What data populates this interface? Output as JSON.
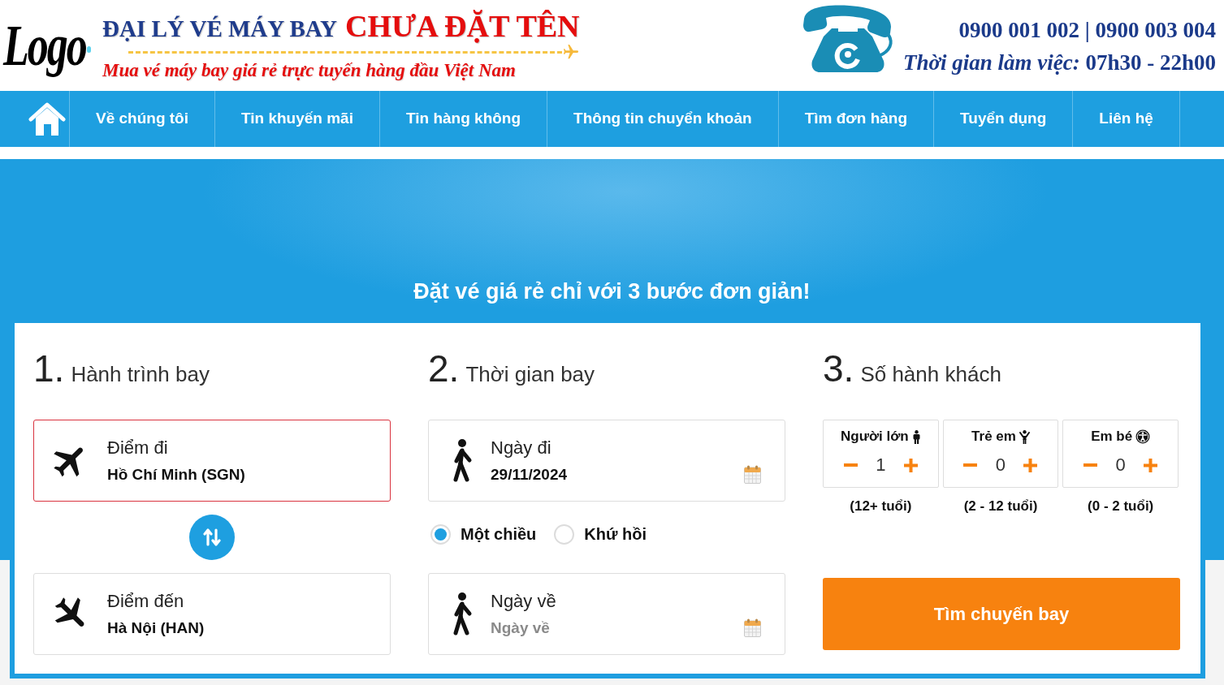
{
  "header": {
    "logo": "Logo",
    "title": "ĐẠI LÝ VÉ MÁY BAY",
    "title_highlight": "CHƯA ĐẶT TÊN",
    "tagline": "Mua vé máy bay giá rẻ trực tuyến hàng đầu Việt Nam",
    "phones": "0900 001 002 | 0900 003 004",
    "hours": "*Thời gian làm việc:* 07h30 - 22h00"
  },
  "nav": {
    "items": [
      "Về chúng tôi",
      "Tin khuyến mãi",
      "Tin hàng không",
      "Thông tin chuyển khoản",
      "Tìm đơn hàng",
      "Tuyển dụng",
      "Liên hệ"
    ]
  },
  "hero": {
    "heading": "Đặt vé giá rẻ chỉ với 3 bước đơn giản!"
  },
  "itinerary": {
    "number": "1.",
    "title": "Hành trình bay",
    "fields": [
      {
        "kind": "departure",
        "label": "Điểm đi",
        "value": "Hồ Chí Minh (SGN)",
        "focused": true
      },
      {
        "kind": "arrival",
        "label": "Điểm đến",
        "value": "Hà Nội (HAN)",
        "focused": false
      }
    ]
  },
  "dates": {
    "number": "2.",
    "title": "Thời gian bay",
    "departure_date": {
      "label": "Ngày đi",
      "value": "29/11/2024"
    },
    "trip_types": [
      {
        "label": "Một chiều",
        "selected": true
      },
      {
        "label": "Khứ hồi",
        "selected": false
      }
    ],
    "return_date": {
      "label": "Ngày về",
      "placeholder": "Ngày về"
    }
  },
  "passengers": {
    "number": "3.",
    "title": "Số hành khách",
    "groups": [
      {
        "kind": "adult",
        "label": "Người lớn",
        "count": "1",
        "age_range": "(12+ tuổi)"
      },
      {
        "kind": "child",
        "label": "Trẻ em",
        "count": "0",
        "age_range": "(2 - 12 tuổi)"
      },
      {
        "kind": "infant",
        "label": "Em bé",
        "count": "0",
        "age_range": "(0 - 2 tuổi)"
      }
    ],
    "search_button": "Tìm chuyến bay"
  }
}
